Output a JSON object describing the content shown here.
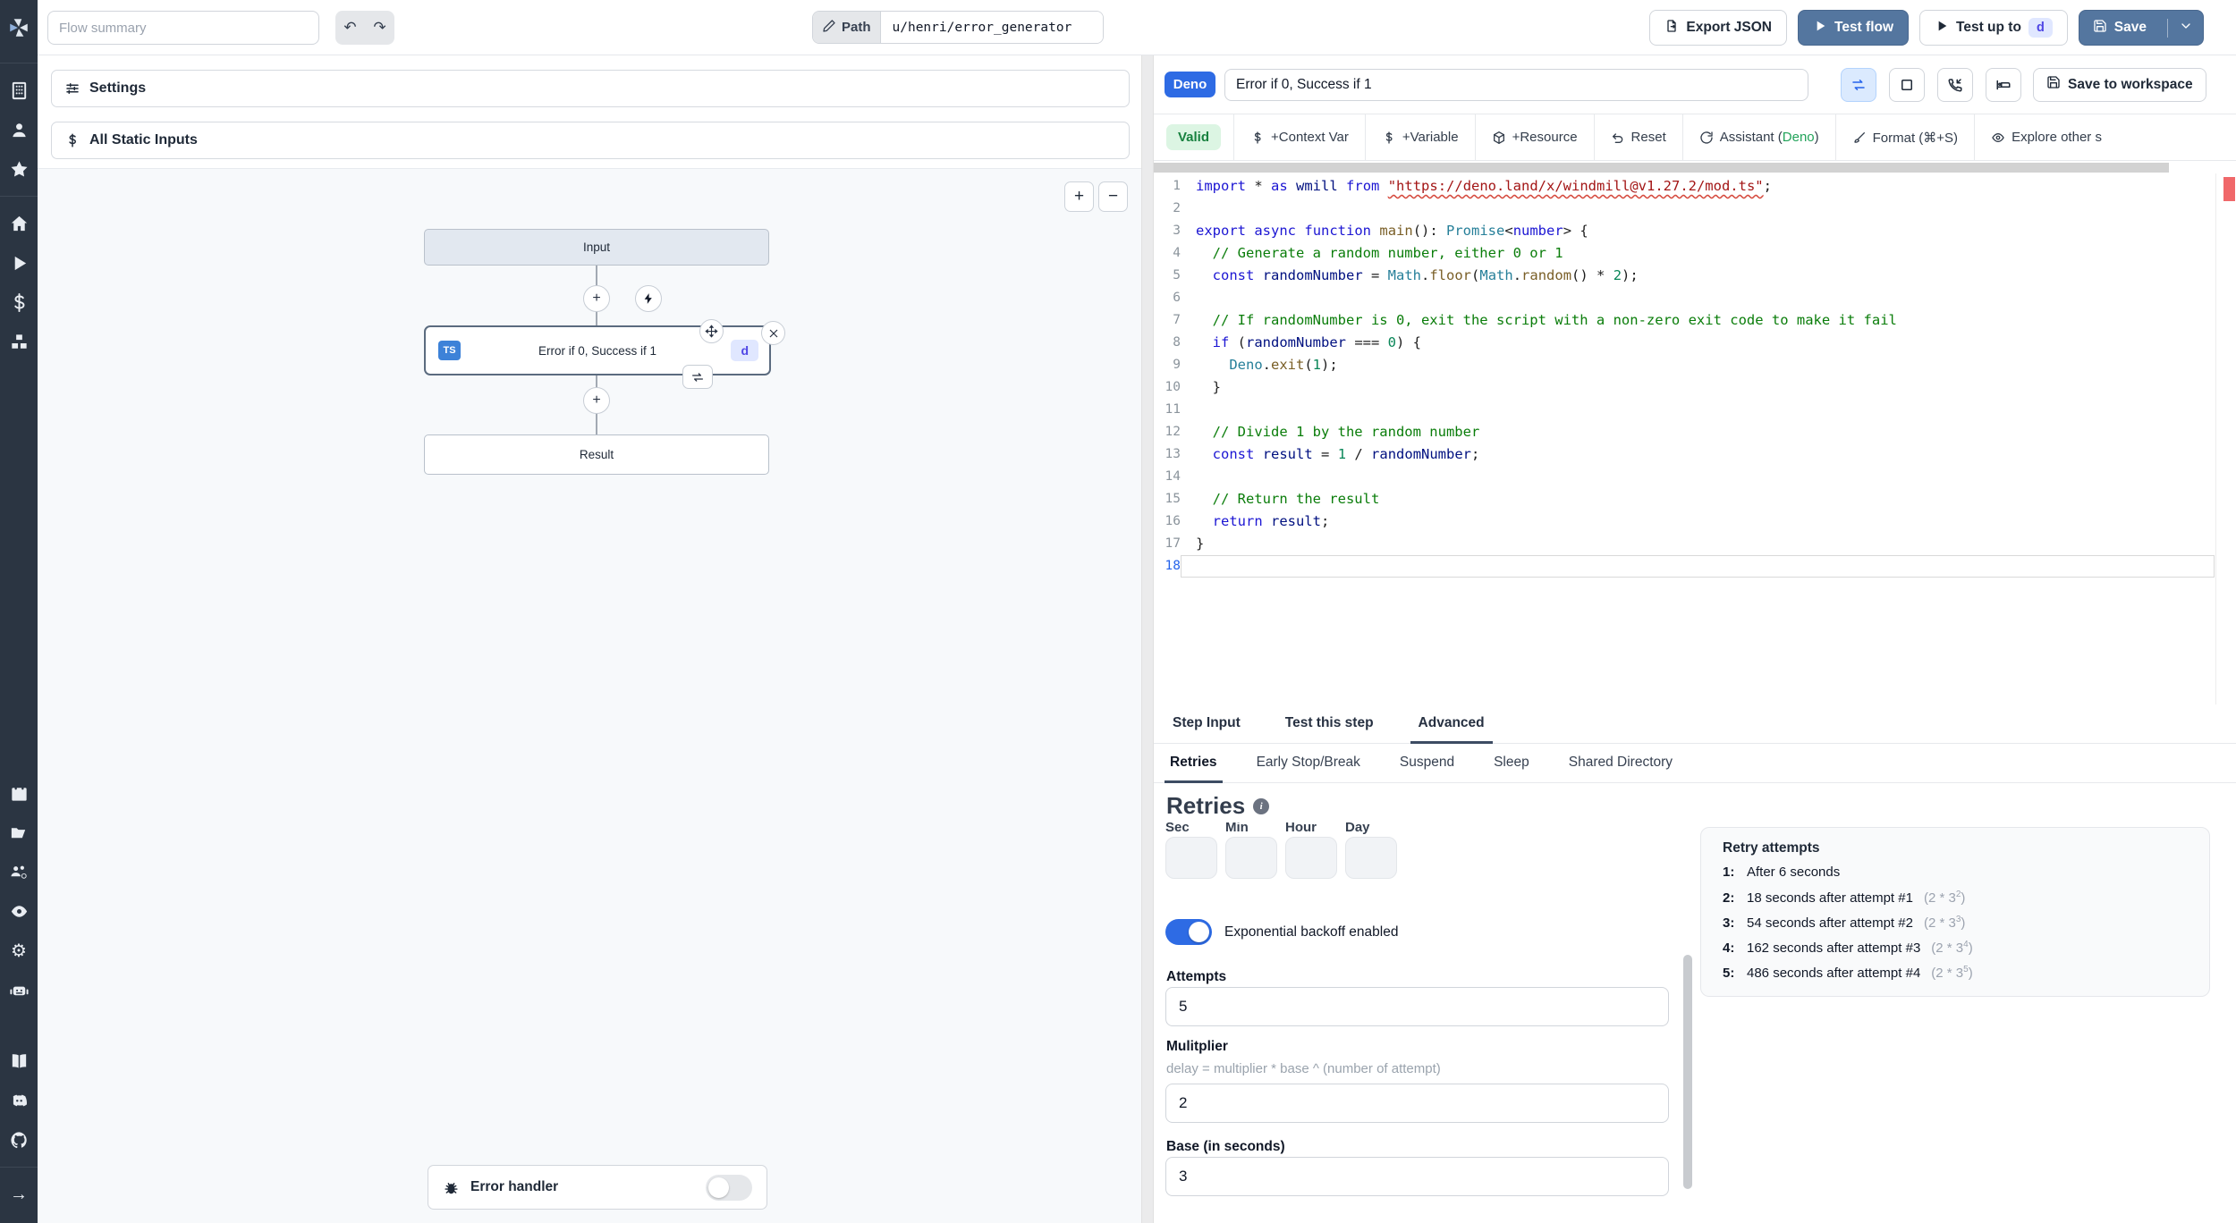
{
  "colors": {
    "sidebar_bg": "#2b3542",
    "primary_button": "#54769f",
    "deno_badge_bg": "#2e6be4",
    "toggle_on": "#2e6be4",
    "valid_bg": "#dcf5e3",
    "valid_text": "#17813f",
    "ts_badge_bg": "#3d82d8",
    "id_badge_bg": "#e0e7ff",
    "error_marker": "#f0686a"
  },
  "sidebar_icon_names": [
    "windmill-logo",
    "building",
    "user",
    "star",
    "home",
    "play",
    "dollar",
    "boxes",
    "calendar",
    "folder-open",
    "user-group-gear",
    "eye",
    "gear",
    "robot",
    "book",
    "discord",
    "github",
    "arrow-right"
  ],
  "topbar": {
    "flow_summary_placeholder": "Flow summary",
    "path_label": "Path",
    "path_value": "u/henri/error_generator",
    "export_json_label": "Export JSON",
    "test_flow_label": "Test flow",
    "test_up_to_label": "Test up to",
    "test_up_to_badge": "d",
    "save_label": "Save"
  },
  "flow": {
    "settings_label": "Settings",
    "static_inputs_label": "All Static Inputs",
    "zoom_in": "+",
    "zoom_out": "−",
    "input_node": "Input",
    "step_node": "Error if 0, Success if 1",
    "step_lang_badge": "TS",
    "step_id_badge": "d",
    "result_node": "Result",
    "error_handler_label": "Error handler"
  },
  "editor": {
    "lang_badge": "Deno",
    "step_name_value": "Error if 0, Success if 1",
    "save_to_workspace_label": "Save to workspace",
    "valid_badge": "Valid",
    "toolbar": {
      "context_var": "+Context Var",
      "variable": "+Variable",
      "resource": "+Resource",
      "reset": "Reset",
      "assistant_prefix": "Assistant (",
      "assistant_lang": "Deno",
      "assistant_suffix": ")",
      "format": "Format (⌘+S)",
      "explore": "Explore other s"
    },
    "code_lines": [
      {
        "tokens": [
          [
            "k",
            "import"
          ],
          [
            "p",
            " * "
          ],
          [
            "k",
            "as"
          ],
          [
            "p",
            " "
          ],
          [
            "v",
            "wmill"
          ],
          [
            "p",
            " "
          ],
          [
            "k",
            "from"
          ],
          [
            "p",
            " "
          ],
          [
            "sq",
            "\"https://deno.land/x/windmill@v1.27.2/mod.ts\""
          ],
          [
            "p",
            ";"
          ]
        ]
      },
      {
        "tokens": []
      },
      {
        "tokens": [
          [
            "k",
            "export"
          ],
          [
            "p",
            " "
          ],
          [
            "k",
            "async"
          ],
          [
            "p",
            " "
          ],
          [
            "k",
            "function"
          ],
          [
            "p",
            " "
          ],
          [
            "f",
            "main"
          ],
          [
            "p",
            "(): "
          ],
          [
            "t",
            "Promise"
          ],
          [
            "p",
            "<"
          ],
          [
            "k",
            "number"
          ],
          [
            "p",
            "> {"
          ]
        ]
      },
      {
        "tokens": [
          [
            "c",
            "  // Generate a random number, either 0 or 1"
          ]
        ]
      },
      {
        "tokens": [
          [
            "p",
            "  "
          ],
          [
            "k",
            "const"
          ],
          [
            "p",
            " "
          ],
          [
            "v",
            "randomNumber"
          ],
          [
            "p",
            " = "
          ],
          [
            "t",
            "Math"
          ],
          [
            "p",
            "."
          ],
          [
            "f",
            "floor"
          ],
          [
            "p",
            "("
          ],
          [
            "t",
            "Math"
          ],
          [
            "p",
            "."
          ],
          [
            "f",
            "random"
          ],
          [
            "p",
            "() * "
          ],
          [
            "n",
            "2"
          ],
          [
            "p",
            ");"
          ]
        ]
      },
      {
        "tokens": []
      },
      {
        "tokens": [
          [
            "c",
            "  // If randomNumber is 0, exit the script with a non-zero exit code to make it fail"
          ]
        ]
      },
      {
        "tokens": [
          [
            "p",
            "  "
          ],
          [
            "k",
            "if"
          ],
          [
            "p",
            " ("
          ],
          [
            "v",
            "randomNumber"
          ],
          [
            "p",
            " === "
          ],
          [
            "n",
            "0"
          ],
          [
            "p",
            ") {"
          ]
        ]
      },
      {
        "tokens": [
          [
            "p",
            "    "
          ],
          [
            "t",
            "Deno"
          ],
          [
            "p",
            "."
          ],
          [
            "f",
            "exit"
          ],
          [
            "p",
            "("
          ],
          [
            "n",
            "1"
          ],
          [
            "p",
            ");"
          ]
        ]
      },
      {
        "tokens": [
          [
            "p",
            "  }"
          ]
        ]
      },
      {
        "tokens": []
      },
      {
        "tokens": [
          [
            "c",
            "  // Divide 1 by the random number"
          ]
        ]
      },
      {
        "tokens": [
          [
            "p",
            "  "
          ],
          [
            "k",
            "const"
          ],
          [
            "p",
            " "
          ],
          [
            "v",
            "result"
          ],
          [
            "p",
            " = "
          ],
          [
            "n",
            "1"
          ],
          [
            "p",
            " / "
          ],
          [
            "v",
            "randomNumber"
          ],
          [
            "p",
            ";"
          ]
        ]
      },
      {
        "tokens": []
      },
      {
        "tokens": [
          [
            "c",
            "  // Return the result"
          ]
        ]
      },
      {
        "tokens": [
          [
            "p",
            "  "
          ],
          [
            "k",
            "return"
          ],
          [
            "p",
            " "
          ],
          [
            "v",
            "result"
          ],
          [
            "p",
            ";"
          ]
        ]
      },
      {
        "tokens": [
          [
            "p",
            "}"
          ]
        ]
      },
      {
        "tokens": [],
        "active": true
      }
    ]
  },
  "tabs": [
    {
      "label": "Step Input",
      "active": false
    },
    {
      "label": "Test this step",
      "active": false
    },
    {
      "label": "Advanced",
      "active": true
    }
  ],
  "subtabs": [
    {
      "label": "Retries",
      "active": true
    },
    {
      "label": "Early Stop/Break",
      "active": false
    },
    {
      "label": "Suspend",
      "active": false
    },
    {
      "label": "Sleep",
      "active": false
    },
    {
      "label": "Shared Directory",
      "active": false
    }
  ],
  "retries": {
    "title": "Retries",
    "time_fields": [
      "Sec",
      "Min",
      "Hour",
      "Day"
    ],
    "backoff_label": "Exponential backoff enabled",
    "attempts_label": "Attempts",
    "attempts_value": "5",
    "multiplier_label": "Mulitplier",
    "multiplier_hint": "delay = multiplier * base ^ (number of attempt)",
    "multiplier_value": "2",
    "base_label": "Base (in seconds)",
    "base_value": "3",
    "panel": {
      "title": "Retry attempts",
      "items": [
        {
          "label": "1:",
          "text": "After 6 seconds"
        },
        {
          "label": "2:",
          "text": "18 seconds after attempt #1",
          "formula_base": "2 * 3",
          "formula_exp": "2"
        },
        {
          "label": "3:",
          "text": "54 seconds after attempt #2",
          "formula_base": "2 * 3",
          "formula_exp": "3"
        },
        {
          "label": "4:",
          "text": "162 seconds after attempt #3",
          "formula_base": "2 * 3",
          "formula_exp": "4"
        },
        {
          "label": "5:",
          "text": "486 seconds after attempt #4",
          "formula_base": "2 * 3",
          "formula_exp": "5"
        }
      ]
    }
  }
}
